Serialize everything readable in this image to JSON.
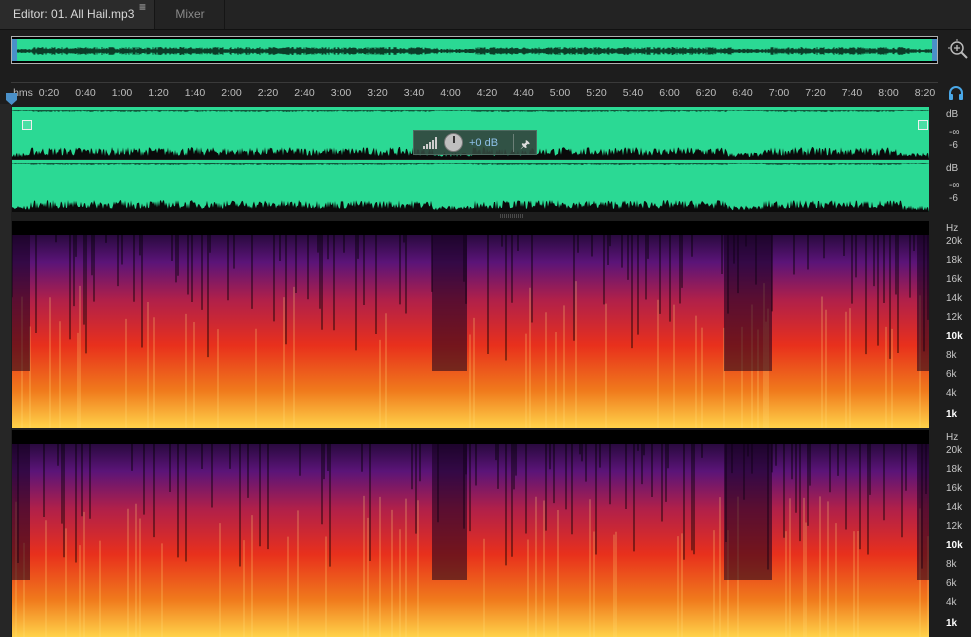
{
  "tabs": {
    "editor_label": "Editor: 01. All Hail.mp3",
    "menu_glyph": "≡",
    "mixer_label": "Mixer"
  },
  "ruler": {
    "format_label": "hms",
    "ticks": [
      "0:20",
      "0:40",
      "1:00",
      "1:20",
      "1:40",
      "2:00",
      "2:20",
      "2:40",
      "3:00",
      "3:20",
      "3:40",
      "4:00",
      "4:20",
      "4:40",
      "5:00",
      "5:20",
      "5:40",
      "6:00",
      "6:20",
      "6:40",
      "7:00",
      "7:20",
      "7:40",
      "8:00",
      "8:20"
    ]
  },
  "amplitude_scale": {
    "unit": "dB",
    "labels": [
      "-∞",
      "-6"
    ]
  },
  "hud": {
    "volume_value": "+0 dB"
  },
  "frequency_scale": {
    "unit": "Hz",
    "labels": [
      "20k",
      "18k",
      "16k",
      "14k",
      "12k",
      "10k",
      "8k",
      "6k",
      "4k",
      "1k"
    ],
    "bold": [
      "10k",
      "1k"
    ]
  },
  "icons": {
    "zoom": "zoom-in-icon",
    "monitor": "headphones-icon",
    "pin": "pin-icon",
    "menu": "panel-menu-icon",
    "playhead": "playhead-marker-icon"
  },
  "colors": {
    "waveform": "#2bd994",
    "accent": "#4a90c8",
    "spectral_low": "#ffd24a",
    "spectral_mid": "#e8301c",
    "spectral_high": "#5b1478"
  }
}
